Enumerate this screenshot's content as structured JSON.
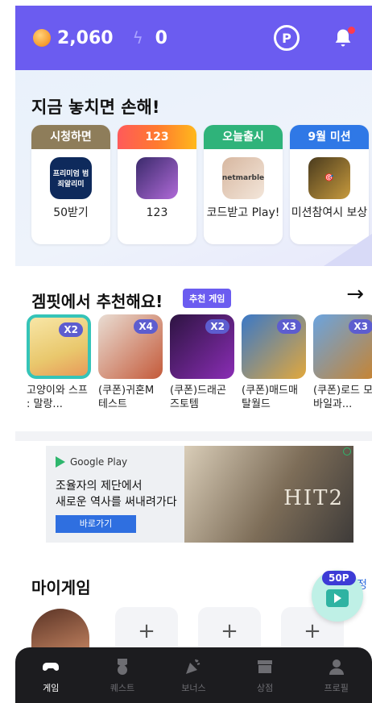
{
  "header": {
    "points": "2,060",
    "energy": "0",
    "icons": [
      "coin-icon",
      "bolt-icon",
      "point-exchange-icon",
      "bell-icon"
    ]
  },
  "offers": {
    "title": "지금 놓치면 손해!",
    "cards": [
      {
        "label": "시청하면",
        "icon_text": "프리미엄 범죄알리미",
        "desc": "50받기"
      },
      {
        "label": "123",
        "icon_text": "",
        "desc": "123"
      },
      {
        "label": "오늘출시",
        "icon_text": "netmarble",
        "desc": "코드받고 Play!"
      },
      {
        "label": "9월 미션",
        "icon_text": "",
        "desc": "미션참여시 보상"
      }
    ]
  },
  "recommend": {
    "title": "겜핏에서 추천해요!",
    "tag": "추천 게임",
    "games": [
      {
        "mult": "X2",
        "name": "고양이와 스프 : 말랑..."
      },
      {
        "mult": "X4",
        "name": "(쿠폰)귀혼M 테스트"
      },
      {
        "mult": "X2",
        "name": "(쿠폰)드래곤 즈토템"
      },
      {
        "mult": "X3",
        "name": "(쿠폰)매드매 탈월드"
      },
      {
        "mult": "X3",
        "name": "(쿠폰)로드 모바일과..."
      }
    ]
  },
  "ad": {
    "store": "Google Play",
    "line1": "조율자의 제단에서",
    "line2": "새로운 역사를 써내려가다",
    "button": "바로가기",
    "logo": "HIT2"
  },
  "mygame": {
    "title": "마이게임",
    "more": "설정",
    "fab_badge": "50P"
  },
  "nav": [
    {
      "label": "게임",
      "active": true
    },
    {
      "label": "퀘스트",
      "active": false
    },
    {
      "label": "보너스",
      "active": false
    },
    {
      "label": "상점",
      "active": false
    },
    {
      "label": "프로필",
      "active": false
    }
  ]
}
